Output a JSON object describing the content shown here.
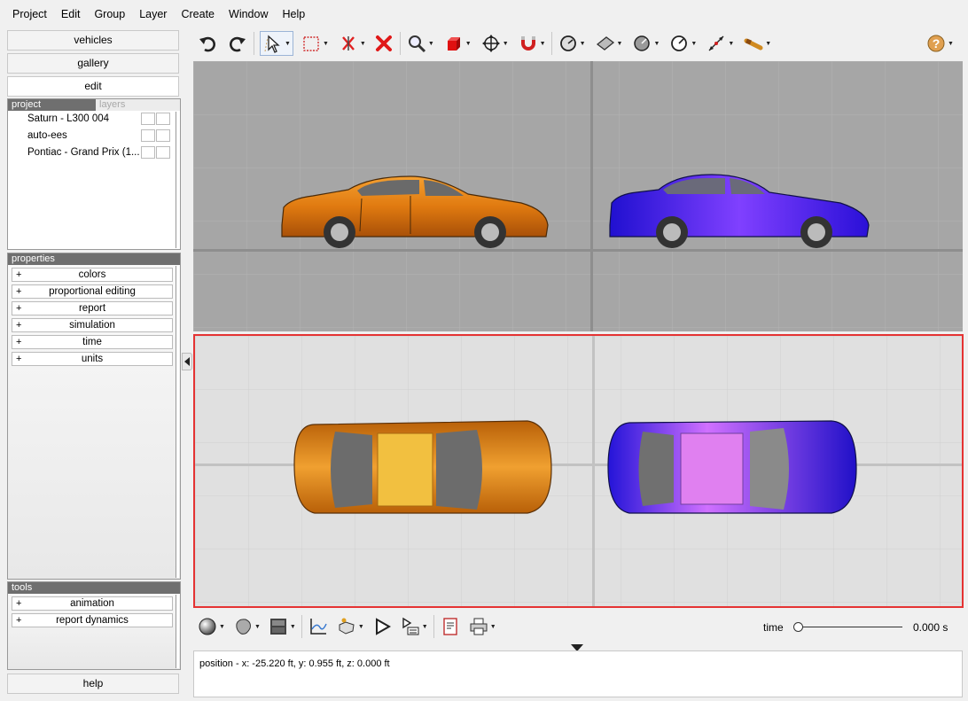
{
  "menu": [
    "Project",
    "Edit",
    "Group",
    "Layer",
    "Create",
    "Window",
    "Help"
  ],
  "nav": {
    "vehicles": "vehicles",
    "gallery": "gallery",
    "edit": "edit",
    "help": "help"
  },
  "project_pane": {
    "tab_project": "project",
    "tab_layers": "layers",
    "items": [
      "Saturn - L300 004",
      "auto-ees",
      "Pontiac - Grand Prix (1..."
    ]
  },
  "properties_pane": {
    "header": "properties",
    "items": [
      "colors",
      "proportional editing",
      "report",
      "simulation",
      "time",
      "units"
    ]
  },
  "tools_pane": {
    "header": "tools",
    "items": [
      "animation",
      "report dynamics"
    ]
  },
  "plus_sign": "+",
  "toolbar_icons": [
    "undo-icon",
    "redo-icon",
    "select-arrow-icon",
    "selection-rect-icon",
    "delete-hide-icon",
    "delete-icon",
    "zoom-icon",
    "cube-icon",
    "move-icon",
    "magnet-icon",
    "tire-icon",
    "surface-icon",
    "disc-icon",
    "gauge-icon",
    "measure-icon",
    "tool-icon",
    "help-icon"
  ],
  "vehicles": [
    {
      "name": "Pontiac - Grand Prix",
      "color": "#e07a10"
    },
    {
      "name": "Saturn - L300",
      "color": "#2a1ae0"
    }
  ],
  "time": {
    "label": "time",
    "value": "0.000 s",
    "position": 0
  },
  "status": {
    "text": "position - x: -25.220 ft, y: 0.955 ft, z: 0.000 ft"
  },
  "colors": {
    "accent_border": "#e53333",
    "panel_header": "#6f6f6f"
  }
}
